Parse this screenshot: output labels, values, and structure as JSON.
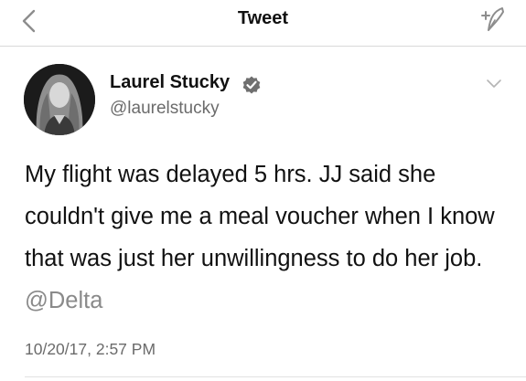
{
  "header": {
    "title": "Tweet",
    "back_icon": "chevron-left-icon",
    "compose_icon": "compose-feather-icon"
  },
  "author": {
    "display_name": "Laurel Stucky",
    "handle": "@laurelstucky",
    "verified": true,
    "avatar_icon": "profile-photo"
  },
  "tweet": {
    "text": "My flight was delayed 5 hrs. JJ said she couldn't give me a meal voucher when I know that was just her unwillingness to do her job.",
    "mention": "@Delta",
    "timestamp": "10/20/17, 2:57 PM"
  },
  "colors": {
    "text": "#111111",
    "secondary_text": "#6b6b6b",
    "mention": "#8a8a8a",
    "divider": "#d9d9d9"
  }
}
